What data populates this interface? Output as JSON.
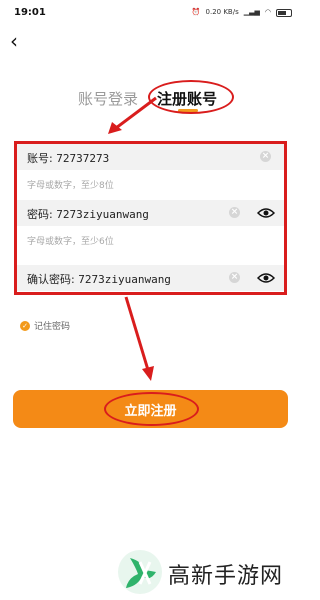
{
  "status_bar": {
    "time": "19:01",
    "net_speed": "0.20 KB/s",
    "icons": [
      "alarm-icon",
      "signal-icon",
      "wifi-icon",
      "battery-icon"
    ]
  },
  "tabs": {
    "login": "账号登录",
    "register": "注册账号"
  },
  "form": {
    "account": {
      "label": "账号:",
      "value": "72737273"
    },
    "account_hint": "字母或数字，至少8位",
    "password": {
      "label": "密码:",
      "value": "7273ziyuanwang"
    },
    "password_hint": "字母或数字，至少6位",
    "confirm": {
      "label": "确认密码:",
      "value": "7273ziyuanwang"
    }
  },
  "remember": {
    "label": "记住密码",
    "checked": true
  },
  "submit": {
    "label": "立即注册"
  },
  "watermark": {
    "text": "高新手游网"
  },
  "colors": {
    "accent": "#f48a16",
    "annotation": "#d91d1d"
  }
}
